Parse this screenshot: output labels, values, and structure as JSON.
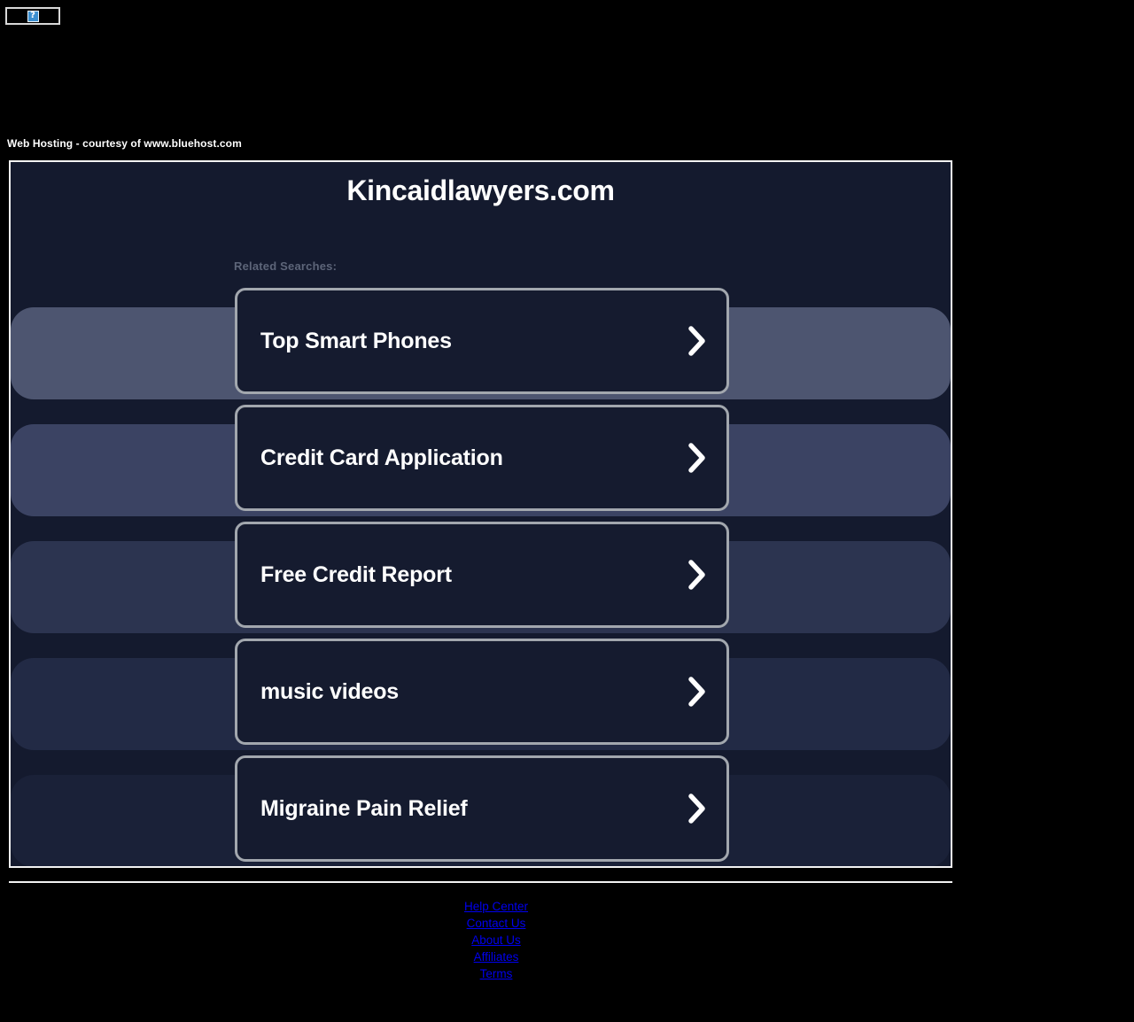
{
  "broken_image": {
    "alt_glyph": "?",
    "icon": "broken-image-icon"
  },
  "hosting_notice": "Web Hosting - courtesy of www.bluehost.com",
  "park_page": {
    "title": "Kincaidlawyers.com",
    "related_label": "Related Searches:",
    "cards": [
      {
        "label": "Top Smart Phones",
        "icon": "chevron-right-icon"
      },
      {
        "label": "Credit Card Application",
        "icon": "chevron-right-icon"
      },
      {
        "label": "Free Credit Report",
        "icon": "chevron-right-icon"
      },
      {
        "label": "music videos",
        "icon": "chevron-right-icon"
      },
      {
        "label": "Migraine Pain Relief",
        "icon": "chevron-right-icon"
      }
    ]
  },
  "footer": {
    "links": [
      "Help Center",
      "Contact Us",
      "About Us",
      "Affiliates",
      "Terms"
    ]
  },
  "colors": {
    "page_background": "#000000",
    "container_background": "#141a2e",
    "container_border": "#f2f2f2",
    "card_background": "#151b2f",
    "card_border": "#a2a7ae",
    "card_text": "#ffffff",
    "related_label": "#5d6579",
    "link": "#0000ee",
    "glow_band_1": "#4d5570",
    "glow_band_2": "#3b4363",
    "glow_band_3": "#2c3450",
    "glow_band_4": "#222a45",
    "glow_band_5": "#1a2138"
  }
}
